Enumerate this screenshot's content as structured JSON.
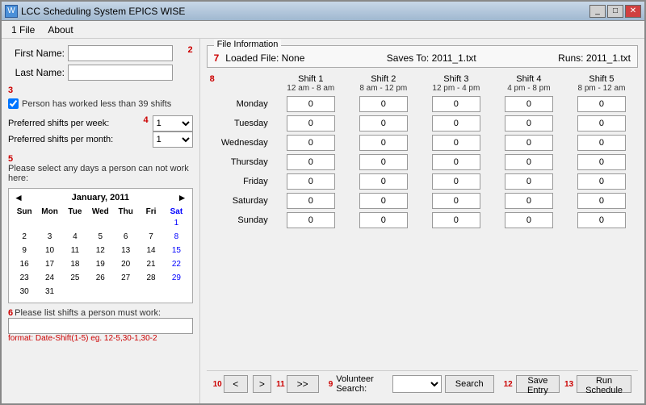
{
  "window": {
    "title": "LCC Scheduling System EPICS WISE",
    "icon": "W"
  },
  "menubar": {
    "items": [
      "1 File",
      "About"
    ]
  },
  "left_panel": {
    "number_2": "2",
    "first_name_label": "First Name:",
    "last_name_label": "Last Name:",
    "number_3": "3",
    "checkbox_label": "Person has worked less than 39 shifts",
    "checkbox_checked": true,
    "preferred_week_label": "Preferred shifts per week:",
    "preferred_month_label": "Preferred shifts per month:",
    "number_4": "4",
    "week_value": "1",
    "month_value": "1",
    "number_5": "5",
    "no_work_label": "Please select any days a person can not work here:",
    "calendar": {
      "month_year": "January, 2011",
      "headers": [
        "Sun",
        "Mon",
        "Tue",
        "Wed",
        "Thu",
        "Fri",
        "Sat"
      ],
      "weeks": [
        [
          "",
          "",
          "",
          "",
          "",
          "",
          "1"
        ],
        [
          "2",
          "3",
          "4",
          "5",
          "6",
          "7",
          "8"
        ],
        [
          "9",
          "10",
          "11",
          "12",
          "13",
          "14",
          "15"
        ],
        [
          "16",
          "17",
          "18",
          "19",
          "20",
          "21",
          "22"
        ],
        [
          "23",
          "24",
          "25",
          "26",
          "27",
          "28",
          "29"
        ],
        [
          "30",
          "31",
          "",
          "",
          "",
          "",
          ""
        ]
      ]
    },
    "number_6": "6",
    "must_work_label": "Please list shifts a person must work:",
    "format_label": "format: Date-Shift(1-5) eg. 12-5,30-1,30-2"
  },
  "right_panel": {
    "file_info": {
      "legend": "File Information",
      "number_7": "7",
      "loaded_label": "Loaded File: None",
      "saves_label": "Saves To: 2011_1.txt",
      "runs_label": "Runs: 2011_1.txt"
    },
    "number_8": "8",
    "shifts": [
      {
        "name": "Shift 1",
        "time": "12 am - 8 am"
      },
      {
        "name": "Shift 2",
        "time": "8 am - 12 pm"
      },
      {
        "name": "Shift 3",
        "time": "12 pm - 4 pm"
      },
      {
        "name": "Shift 4",
        "time": "4 pm - 8 pm"
      },
      {
        "name": "Shift 5",
        "time": "8 pm - 12 am"
      }
    ],
    "days": [
      "Monday",
      "Tuesday",
      "Wednesday",
      "Thursday",
      "Friday",
      "Saturday",
      "Sunday"
    ],
    "cell_value": "0"
  },
  "bottom_bar": {
    "number_9": "9",
    "number_10": "10",
    "number_11": "11",
    "number_12": "12",
    "number_13": "13",
    "prev_btn": "<",
    "next_btn": ">",
    "skip_btn": ">>",
    "volunteer_label": "Volunteer Search:",
    "search_btn": "Search",
    "save_btn": "Save Entry",
    "run_btn": "Run Schedule"
  }
}
